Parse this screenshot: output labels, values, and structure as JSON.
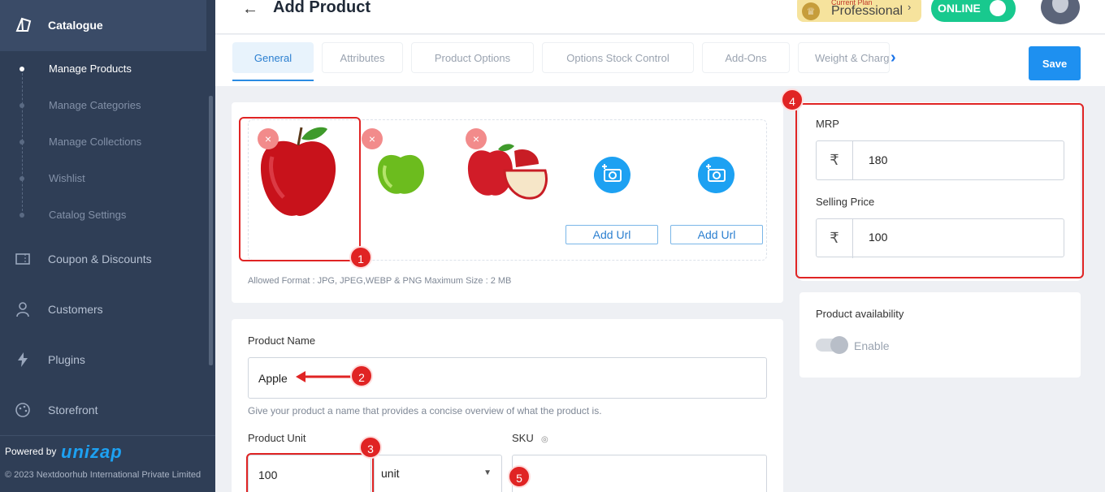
{
  "sidebar": {
    "section_title": "Catalogue",
    "sub_items": [
      {
        "label": "Manage Products",
        "active": true
      },
      {
        "label": "Manage Categories",
        "active": false
      },
      {
        "label": "Manage Collections",
        "active": false
      },
      {
        "label": "Wishlist",
        "active": false
      },
      {
        "label": "Catalog Settings",
        "active": false
      }
    ],
    "nav_items": [
      {
        "label": "Coupon & Discounts",
        "icon": "ticket-icon"
      },
      {
        "label": "Customers",
        "icon": "user-icon"
      },
      {
        "label": "Plugins",
        "icon": "bolt-icon"
      },
      {
        "label": "Storefront",
        "icon": "palette-icon"
      }
    ],
    "powered_by": "Powered by",
    "brand": "unizap",
    "copyright": "© 2023 Nextdoorhub International Private Limited"
  },
  "header": {
    "title": "Add Product",
    "plan_caption": "Current Plan",
    "plan_name": "Professional",
    "status_label": "ONLINE"
  },
  "tabs": [
    {
      "label": "General",
      "active": true
    },
    {
      "label": "Attributes",
      "active": false
    },
    {
      "label": "Product Options",
      "active": false
    },
    {
      "label": "Options Stock Control",
      "active": false
    },
    {
      "label": "Add-Ons",
      "active": false
    },
    {
      "label": "Weight & Charges",
      "active": false
    }
  ],
  "save_label": "Save",
  "images": {
    "add_url_label": "Add Url",
    "allowed_format": "Allowed Format : JPG, JPEG,WEBP & PNG Maximum Size : 2 MB"
  },
  "form": {
    "product_name_label": "Product Name",
    "product_name_value": "Apple",
    "product_name_hint": "Give your product a name that provides a concise overview of what the product is.",
    "product_unit_label": "Product Unit",
    "product_unit_value": "100",
    "unit_select_value": "unit",
    "sku_label": "SKU",
    "sku_value": ""
  },
  "pricing": {
    "mrp_label": "MRP",
    "mrp_value": "180",
    "selling_price_label": "Selling Price",
    "selling_price_value": "100",
    "currency_symbol": "₹"
  },
  "availability": {
    "label": "Product availability",
    "toggle_label": "Enable"
  },
  "annotations": [
    "1",
    "2",
    "3",
    "4",
    "5"
  ],
  "colors": {
    "sidebar_bg": "#2f3e56",
    "accent": "#1e90f0",
    "annotation_red": "#e02424",
    "online_green": "#18c98e"
  }
}
